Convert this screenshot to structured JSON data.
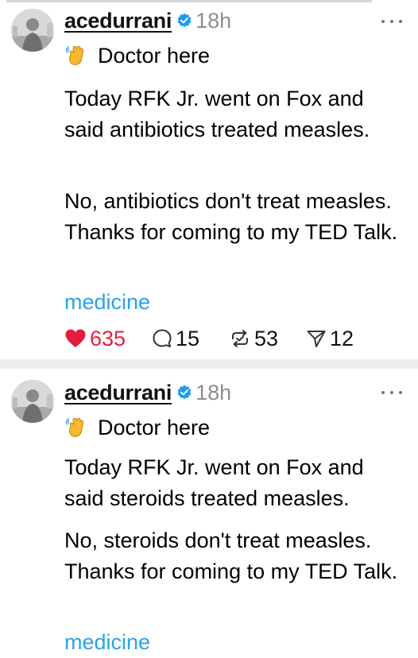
{
  "posts": [
    {
      "username": "acedurrani",
      "timestamp": "18h",
      "intro": "Doctor here",
      "paragraphs": [
        "Today RFK Jr. went on Fox and said antibiotics treated measles.",
        "No, antibiotics don't treat measles. Thanks for coming to my TED Talk."
      ],
      "tag": "medicine",
      "stats": {
        "likes": "635",
        "replies": "15",
        "reposts": "53",
        "shares": "12"
      }
    },
    {
      "username": "acedurrani",
      "timestamp": "18h",
      "intro": "Doctor here",
      "paragraphs": [
        "Today RFK Jr. went on Fox and said steroids treated measles.",
        "No, steroids don't treat measles. Thanks for coming to my TED Talk."
      ],
      "tag": "medicine"
    }
  ],
  "icons": {
    "verified": "verified-badge-icon",
    "wave": "waving-hand-emoji",
    "more": "more-options-icon",
    "like": "heart-icon",
    "reply": "comment-icon",
    "repost": "repost-icon",
    "share": "send-icon"
  },
  "colors": {
    "like_active": "#e41e3f",
    "tag": "#2aa3e6",
    "verified": "#1d9bf0",
    "timestamp": "#8e8e8e",
    "separator": "#ececec"
  }
}
